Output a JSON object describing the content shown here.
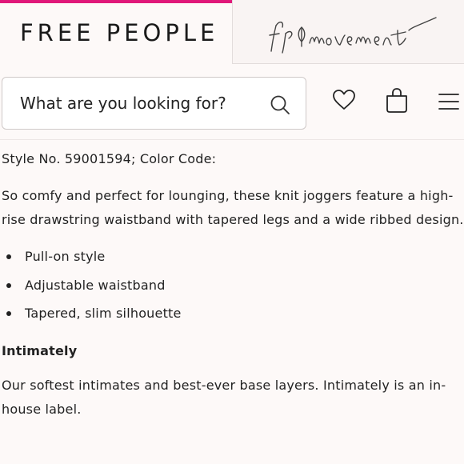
{
  "brand": {
    "primary": "FREE PEOPLE",
    "secondary": "fp movement",
    "accent_color": "#e0187a"
  },
  "search": {
    "placeholder": "What are you looking for?"
  },
  "header_icons": [
    "heart-icon",
    "bag-icon",
    "menu-icon",
    "search-icon"
  ],
  "product": {
    "style_line": "Style No. 59001594; Color Code:",
    "description": "So comfy and perfect for lounging, these knit joggers feature a high-rise drawstring waistband with tapered legs and a wide ribbed design.",
    "features": [
      "Pull-on style",
      "Adjustable waistband",
      "Tapered, slim silhouette"
    ],
    "label_title": "Intimately",
    "label_description": "Our softest intimates and best-ever base layers. Intimately is an in-house label."
  }
}
